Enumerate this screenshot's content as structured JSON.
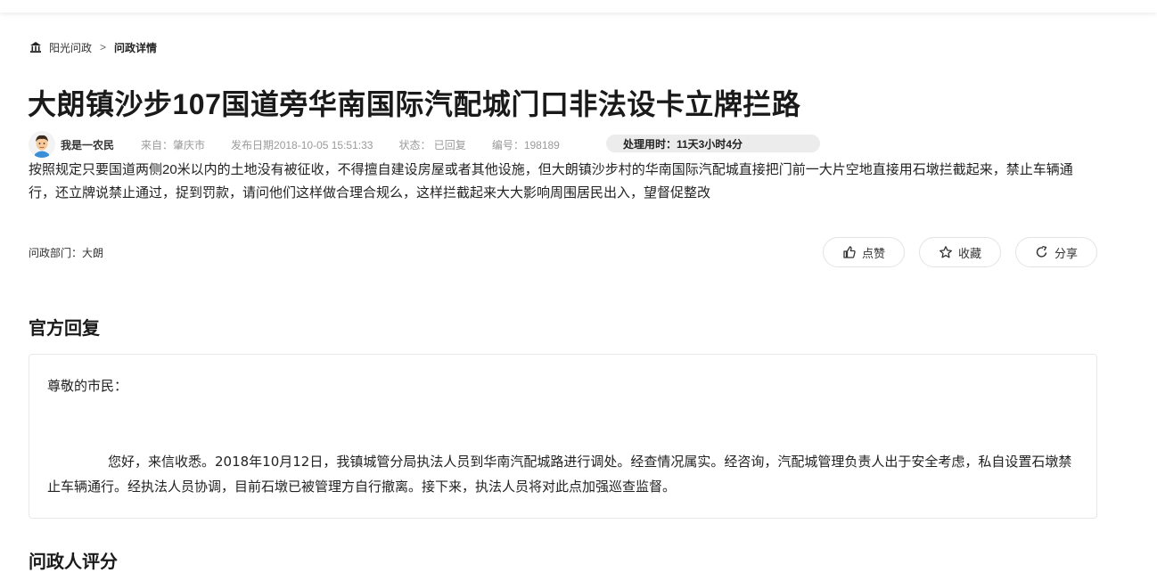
{
  "breadcrumb": {
    "home_icon": "home-icon",
    "root": "阳光问政",
    "separator": ">",
    "current": "问政详情"
  },
  "post": {
    "title": "大朗镇沙步107国道旁华南国际汽配城门口非法设卡立牌拦路",
    "author": "我是一农民",
    "source": "来自：肇庆市",
    "publish_date": "发布日期2018-10-05 15:51:33",
    "status": "状态：  已回复",
    "number": "编号：198189",
    "processing_time": "处理用时：11天3小时4分",
    "content": "按照规定只要国道两侧20米以内的土地没有被征收，不得擅自建设房屋或者其他设施，但大朗镇沙步村的华南国际汽配城直接把门前一大片空地直接用石墩拦截起来，禁止车辆通行，还立牌说禁止通过，捉到罚款，请问他们这样做合理合规么，这样拦截起来大大影响周围居民出入，望督促整改",
    "department": "问政部门：大朗"
  },
  "actions": {
    "like": "点赞",
    "favorite": "收藏",
    "share": "分享"
  },
  "reply": {
    "section_title": "官方回复",
    "greeting": "尊敬的市民：",
    "body": "您好，来信收悉。2018年10月12日，我镇城管分局执法人员到华南汽配城路进行调处。经查情况属实。经咨询，汽配城管理负责人出于安全考虑，私自设置石墩禁止车辆通行。经执法人员协调，目前石墩已被管理方自行撤离。接下来，执法人员将对此点加强巡查监督。"
  },
  "rating": {
    "section_title": "问政人评分"
  }
}
